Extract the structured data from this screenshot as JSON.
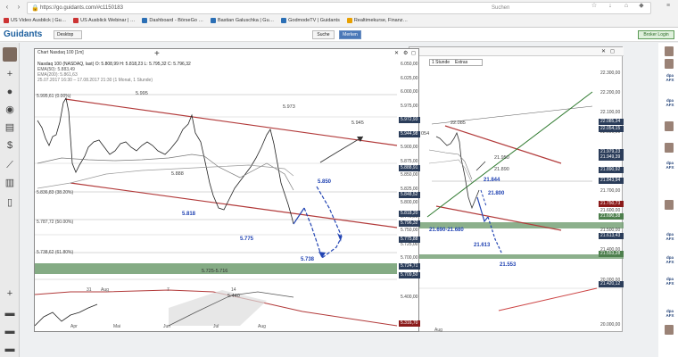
{
  "browser": {
    "url": "https://go.guidants.com/#c1150183",
    "search_placeholder": "Suchen"
  },
  "bookmarks": [
    "US Video Ausblick | Gu…",
    "US Ausblick Webinar | …",
    "Dashboard - BörseGo …",
    "Bastian Galuschka | Gu…",
    "GodmodeTV | Guidants",
    "Realtimekurse, Finanz…"
  ],
  "app": {
    "logo": "Guidants",
    "desktop_label": "Desktop",
    "search_label": "Suche",
    "merken_label": "Merken",
    "broker_label": "Broker Login"
  },
  "main_chart": {
    "title": "Chart Nasdaq 100 [1m]",
    "legend": [
      "Nasdaq 100 (NASDAQ, last)  O: 5.808,99  H: 5.818,23  L: 5.795,32  C: 5.796,32",
      "EMA(50): 5.883,49",
      "EMA(200): 5.861,63",
      "25.07.2017 16:30 – 17.08.2017 21:30  (1 Monat, 1 Stunde)"
    ],
    "price_axis": [
      "6.050,00",
      "6.025,00",
      "6.000,00",
      "5.975,00",
      "5.950,00",
      "5.925,00",
      "5.900,00",
      "5.875,00",
      "5.850,00",
      "5.825,00",
      "5.800,00",
      "5.775,00",
      "5.750,00",
      "5.725,00",
      "5.700,00"
    ],
    "fib_labels": [
      "5.995,61 (0.00%)",
      "5.836,83 (38.20%)",
      "5.787,72 (50.00%)",
      "5.738,62 (61.80%)"
    ],
    "levels": [
      "5.995",
      "5.973",
      "5.945",
      "5.888",
      "5.850",
      "5.818",
      "5.775",
      "5.738",
      "5.725-5.716"
    ],
    "tags": [
      {
        "v": "5.972,93",
        "c": "blue"
      },
      {
        "v": "5.944,98",
        "c": "blue"
      },
      {
        "v": "5.888,91",
        "c": "blue"
      },
      {
        "v": "5.848,52",
        "c": "blue"
      },
      {
        "v": "5.818,20",
        "c": "blue"
      },
      {
        "v": "5.796,32",
        "c": "blue"
      },
      {
        "v": "5.775,88",
        "c": "blue"
      },
      {
        "v": "5.724,71",
        "c": "blue"
      },
      {
        "v": "5.709,50",
        "c": "blue"
      },
      {
        "v": "5.316,70",
        "c": "red"
      }
    ],
    "x_labels": [
      "31",
      "Aug",
      "7",
      "14"
    ],
    "sub_x_labels": [
      "Apr",
      "Mai",
      "Jun",
      "Jul",
      "Aug"
    ],
    "sub_labels": [
      "5.440",
      "5.400,00"
    ]
  },
  "second_chart": {
    "toolbar": [
      "1 Stunde",
      "Extras"
    ],
    "price_axis": [
      "22.300,00",
      "22.200,00",
      "22.100,00",
      "22.000,00",
      "21.900,00",
      "21.800,00",
      "21.700,00",
      "21.600,00",
      "21.500,00",
      "21.400,00",
      "20.000,00",
      "20.000,00"
    ],
    "levels": [
      "22.085",
      "21.950",
      "21.890",
      "21.844",
      "21.800",
      "21.690-21.680",
      "21.613",
      "21.553"
    ],
    "prefix": "054",
    "tags": [
      {
        "v": "22.085,34",
        "c": "blue"
      },
      {
        "v": "22.054,15",
        "c": "blue"
      },
      {
        "v": "21.979,23",
        "c": "blue"
      },
      {
        "v": "21.949,39",
        "c": "blue"
      },
      {
        "v": "21.890,92",
        "c": "blue"
      },
      {
        "v": "21.843,94",
        "c": "blue"
      },
      {
        "v": "21.750,73",
        "c": "red"
      },
      {
        "v": "21.690,38",
        "c": "green"
      },
      {
        "v": "21.613,43",
        "c": "blue"
      },
      {
        "v": "21.553,28",
        "c": "green"
      },
      {
        "v": "21.420,12",
        "c": "blue"
      }
    ],
    "x_label": "Aug"
  },
  "rightbar_labels": [
    "dpa AFX",
    "dpa AFX",
    "dpa AFX",
    "dpa AFX",
    "dpa AFX",
    "dpa AFX",
    "dpa AFX"
  ]
}
